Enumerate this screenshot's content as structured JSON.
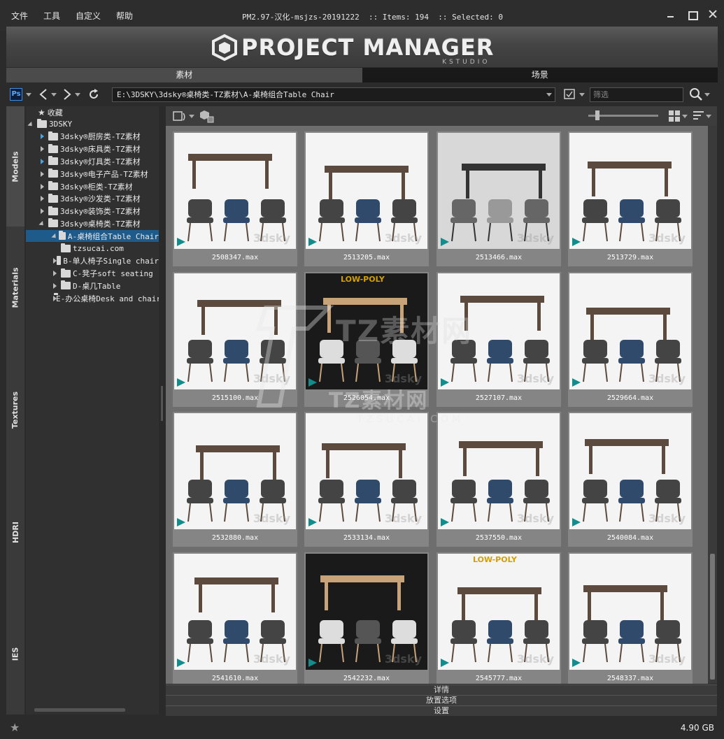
{
  "menu": [
    "文件",
    "工具",
    "自定义",
    "帮助"
  ],
  "status_line": "PM2.97-汉化-msjzs-20191222  :: Items: 194  :: Selected: 0",
  "logo": {
    "title": "PROJECT MANAGER",
    "sub": "KSTUDIO"
  },
  "tabs": {
    "assets": "素材",
    "scenes": "场景"
  },
  "toolbar": {
    "ps_label": "Ps",
    "path": "E:\\3DSKY\\3dsky®桌椅类-TZ素材\\A-桌椅组合Table Chair",
    "filter_placeholder": "筛选"
  },
  "vtabs": [
    "Models",
    "Materials",
    "Textures",
    "HDRI",
    "IES"
  ],
  "tree": [
    {
      "label": "收藏",
      "kind": "favorites"
    },
    {
      "label": "3DSKY",
      "kind": "root"
    },
    {
      "label": "3dsky®厨房类-TZ素材",
      "kind": "child"
    },
    {
      "label": "3dsky®床具类-TZ素材",
      "kind": "child"
    },
    {
      "label": "3dsky®灯具类-TZ素材",
      "kind": "child"
    },
    {
      "label": "3dsky®电子产品-TZ素材",
      "kind": "child"
    },
    {
      "label": "3dsky®柜类-TZ素材",
      "kind": "child"
    },
    {
      "label": "3dsky®沙发类-TZ素材",
      "kind": "child"
    },
    {
      "label": "3dsky®装饰类-TZ素材",
      "kind": "child"
    },
    {
      "label": "3dsky®桌椅类-TZ素材",
      "kind": "child-open"
    },
    {
      "label": "A-桌椅组合Table Chair",
      "kind": "selected"
    },
    {
      "label": "tzsucai.com",
      "kind": "leaf"
    },
    {
      "label": "B-单人椅子Single chair",
      "kind": "sub"
    },
    {
      "label": "C-凳子soft seating",
      "kind": "sub"
    },
    {
      "label": "D-桌几Table",
      "kind": "sub"
    },
    {
      "label": "E-办公桌椅Desk and chair",
      "kind": "sub"
    }
  ],
  "items": [
    {
      "name": "2508347.max",
      "style": "light"
    },
    {
      "name": "2513205.max",
      "style": "light"
    },
    {
      "name": "2513466.max",
      "style": "grey"
    },
    {
      "name": "2513729.max",
      "style": "light"
    },
    {
      "name": "2515100.max",
      "style": "light"
    },
    {
      "name": "2526054.max",
      "style": "dark"
    },
    {
      "name": "2527107.max",
      "style": "light"
    },
    {
      "name": "2529664.max",
      "style": "light"
    },
    {
      "name": "2532880.max",
      "style": "light"
    },
    {
      "name": "2533134.max",
      "style": "light"
    },
    {
      "name": "2537550.max",
      "style": "light"
    },
    {
      "name": "2540084.max",
      "style": "light"
    },
    {
      "name": "2541610.max",
      "style": "light"
    },
    {
      "name": "2542232.max",
      "style": "dark"
    },
    {
      "name": "2545777.max",
      "style": "light"
    },
    {
      "name": "2548337.max",
      "style": "light"
    }
  ],
  "thumb_overlays": {
    "low_poly": "LOW-POLY",
    "brand": "3dsky"
  },
  "panels": [
    "详情",
    "放置选项",
    "设置"
  ],
  "watermark": {
    "cn": "TZ素材网",
    "big": "TZ素材网",
    "en": "TZSUCAI.COM"
  },
  "disk_size": "4.90 GB",
  "colors": {
    "accent": "#1e5a8a",
    "max_badge": "#138c8c"
  }
}
